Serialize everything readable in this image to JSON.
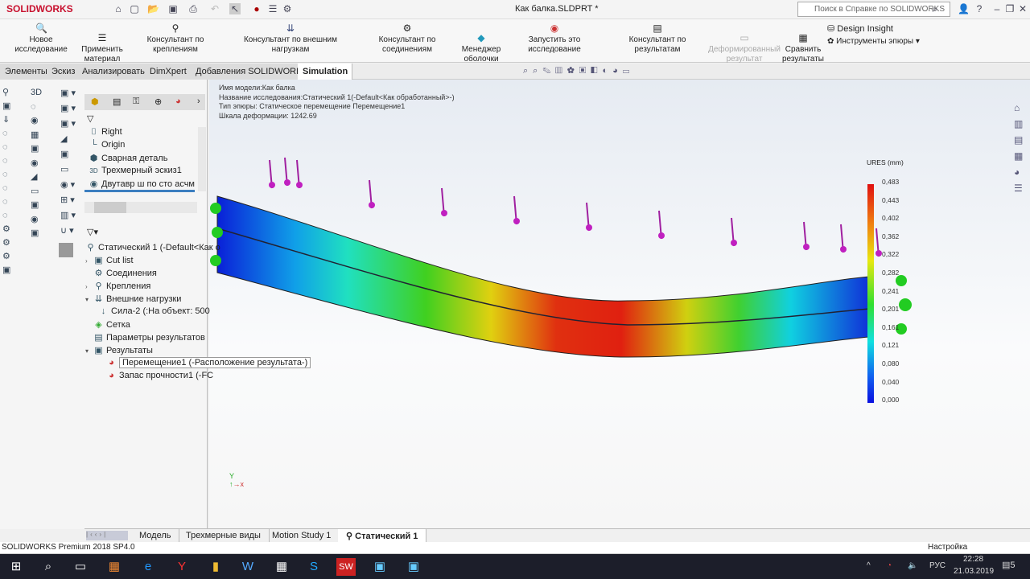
{
  "app": {
    "logo": "SOLIDWORKS",
    "doc_title": "Как балка.SLDPRT *",
    "search_placeholder": "Поиск в Справке по SOLIDWORKS"
  },
  "ribbon": {
    "items": [
      "Новое исследование",
      "Применить материал",
      "Консультант по креплениям",
      "Консультант по внешним нагрузкам",
      "Консультант по соединениям",
      "Менеджер оболочки",
      "Запустить это исследование",
      "Консультант по результатам",
      "Деформированный результат",
      "Сравнить результаты",
      "Design Insight",
      "Инструменты эпюры"
    ]
  },
  "tabs": [
    "Элементы",
    "Эскиз",
    "Анализировать",
    "DimXpert",
    "Добавления SOLIDWORKS",
    "Simulation"
  ],
  "feature_tree": [
    "Right",
    "Origin",
    "Сварная деталь",
    "Трехмерный эскиз1",
    "Двутавр ш по сто асчм"
  ],
  "sim_tree": {
    "root": "Статический 1 (-Default<Как о",
    "items": [
      "Cut list",
      "Соединения",
      "Крепления",
      "Внешние нагрузки",
      "Сила-2 (:На объект: 500",
      "Сетка",
      "Параметры результатов",
      "Результаты",
      "Перемещение1 (-Расположение результата-)",
      "Запас прочности1 (-FC"
    ]
  },
  "info": [
    "Имя модели:Как балка",
    "Название исследования:Статический 1(-Default<Как обработанный>-)",
    "Тип эпюры: Статическое перемещение Перемещение1",
    "Шкала деформации: 1242.69"
  ],
  "legend": {
    "title": "URES (mm)",
    "values": [
      "0,483",
      "0,443",
      "0,402",
      "0,362",
      "0,322",
      "0,282",
      "0,241",
      "0,201",
      "0,161",
      "0,121",
      "0,080",
      "0,040",
      "0,000"
    ]
  },
  "bottom_tabs": [
    "Модель",
    "Трехмерные виды",
    "Motion Study 1",
    "Статический 1"
  ],
  "status": {
    "text": "SOLIDWORKS Premium 2018 SP4.0",
    "custom": "Настройка"
  },
  "taskbar": {
    "lang": "РУС",
    "time": "22:28",
    "date": "21.03.2019",
    "notifications": "5"
  }
}
